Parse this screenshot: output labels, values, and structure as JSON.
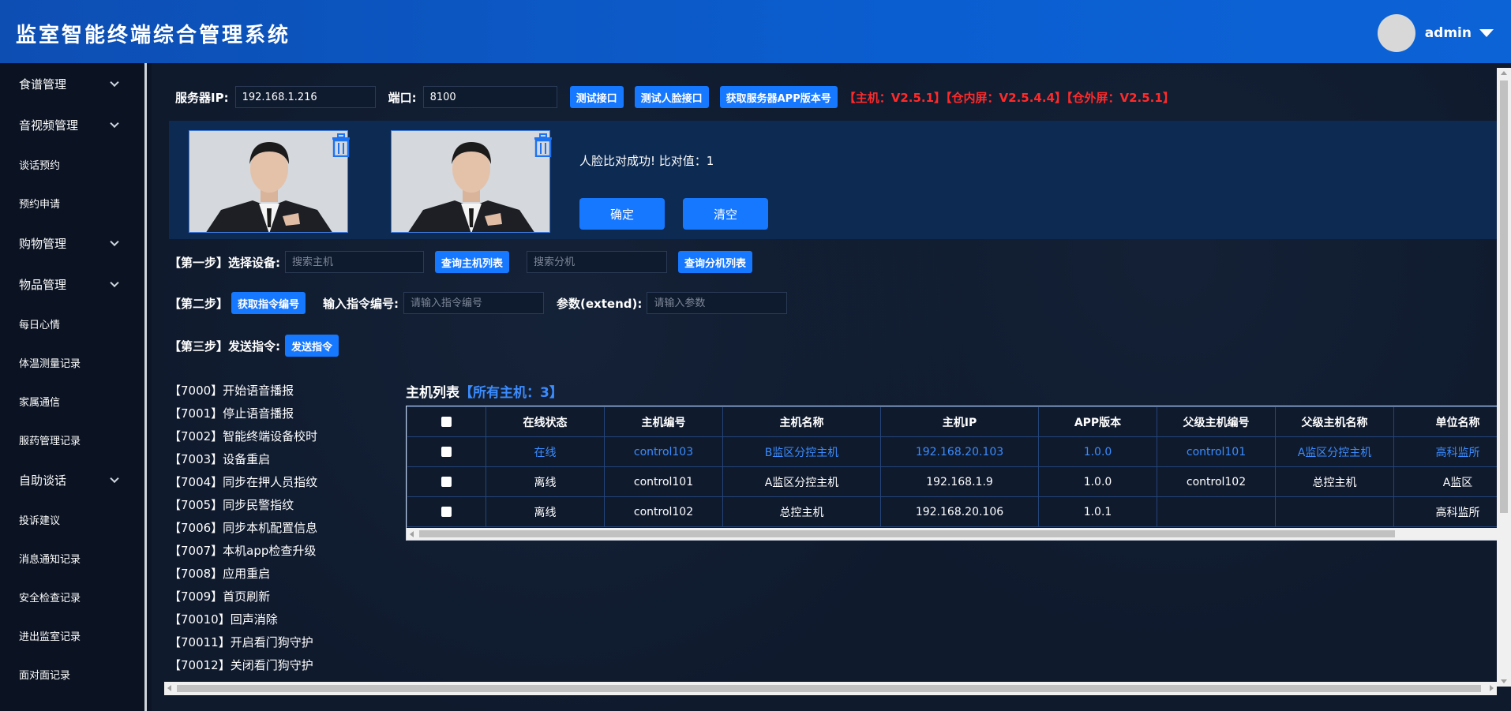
{
  "header": {
    "title": "监室智能终端综合管理系统",
    "username": "admin"
  },
  "sidebar": {
    "items": [
      {
        "label": "食谱管理",
        "group": true
      },
      {
        "label": "音视频管理",
        "group": true
      },
      {
        "label": "谈话预约",
        "group": false
      },
      {
        "label": "预约申请",
        "group": false
      },
      {
        "label": "购物管理",
        "group": true
      },
      {
        "label": "物品管理",
        "group": true
      },
      {
        "label": "每日心情",
        "group": false
      },
      {
        "label": "体温测量记录",
        "group": false
      },
      {
        "label": "家属通信",
        "group": false
      },
      {
        "label": "服药管理记录",
        "group": false
      },
      {
        "label": "自助谈话",
        "group": true
      },
      {
        "label": "投诉建议",
        "group": false
      },
      {
        "label": "消息通知记录",
        "group": false
      },
      {
        "label": "安全检查记录",
        "group": false
      },
      {
        "label": "进出监室记录",
        "group": false
      },
      {
        "label": "面对面记录",
        "group": false
      }
    ]
  },
  "server": {
    "ip_label": "服务器IP:",
    "ip_value": "192.168.1.216",
    "port_label": "端口:",
    "port_value": "8100",
    "btn_test": "测试接口",
    "btn_face": "测试人脸接口",
    "btn_version": "获取服务器APP版本号",
    "version_text": "【主机：V2.5.1】【仓内屏：V2.5.4.4】【仓外屏：V2.5.1】"
  },
  "face": {
    "result": "人脸比对成功! 比对值：1",
    "btn_ok": "确定",
    "btn_clear": "清空"
  },
  "step1": {
    "label": "【第一步】选择设备:",
    "host_placeholder": "搜索主机",
    "btn_host": "查询主机列表",
    "ext_placeholder": "搜索分机",
    "btn_ext": "查询分机列表"
  },
  "step2": {
    "label": "【第二步】",
    "btn_get": "获取指令编号",
    "input_label": "输入指令编号:",
    "input_placeholder": "请输入指令编号",
    "param_label": "参数(extend):",
    "param_placeholder": "请输入参数"
  },
  "step3": {
    "label": "【第三步】发送指令:",
    "btn_send": "发送指令"
  },
  "commands": [
    "【7000】开始语音播报",
    "【7001】停止语音播报",
    "【7002】智能终端设备校时",
    "【7003】设备重启",
    "【7004】同步在押人员指纹",
    "【7005】同步民警指纹",
    "【7006】同步本机配置信息",
    "【7007】本机app检查升级",
    "【7008】应用重启",
    "【7009】首页刷新",
    "【70010】回声消除",
    "【70011】开启看门狗守护",
    "【70012】关闭看门狗守护"
  ],
  "host_table": {
    "title": "主机列表",
    "count": "【所有主机：3】",
    "columns": [
      "在线状态",
      "主机编号",
      "主机名称",
      "主机IP",
      "APP版本",
      "父级主机编号",
      "父级主机名称",
      "单位名称"
    ],
    "rows": [
      {
        "cells": [
          "在线",
          "control103",
          "B监区分控主机",
          "192.168.20.103",
          "1.0.0",
          "control101",
          "A监区分控主机",
          "高科监所"
        ],
        "highlight": true
      },
      {
        "cells": [
          "离线",
          "control101",
          "A监区分控主机",
          "192.168.1.9",
          "1.0.0",
          "control102",
          "总控主机",
          "A监区"
        ],
        "highlight": false
      },
      {
        "cells": [
          "离线",
          "control102",
          "总控主机",
          "192.168.20.106",
          "1.0.1",
          "",
          "",
          "高科监所"
        ],
        "highlight": false
      }
    ]
  },
  "colors": {
    "header_blue": "#0b5ed0",
    "button_blue": "#1677ff",
    "version_red": "#ff2a2a",
    "online_blue": "#3b8cff"
  }
}
